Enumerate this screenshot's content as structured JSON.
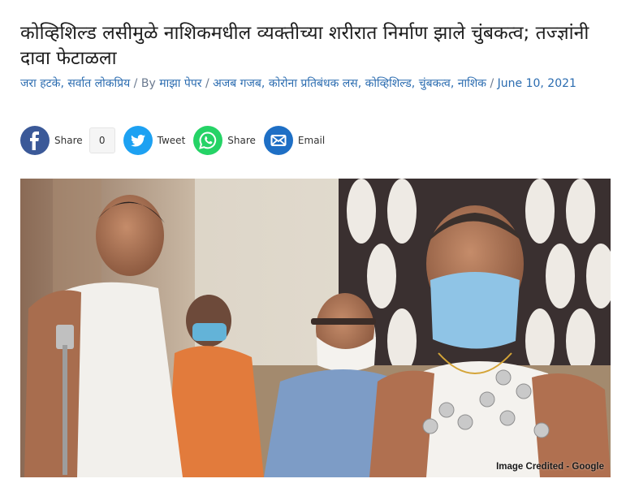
{
  "article": {
    "title": "कोव्हिशिल्ड लसीमुळे नाशिकमधील व्यक्तीच्या शरीरात निर्माण झाले चुंबकत्व; तज्ज्ञांनी दावा फेटाळला",
    "categories": [
      "जरा हटके",
      "सर्वात लोकप्रिय"
    ],
    "separator": " / ",
    "byline_prefix": "By ",
    "author": "माझा पेपर",
    "tags": [
      "अजब गजब",
      "कोरोना प्रतिबंधक लस",
      "कोव्हिशिल्ड",
      "चुंबकत्व",
      "नाशिक"
    ],
    "date": "June 10, 2021"
  },
  "share": {
    "facebook": {
      "label": "Share",
      "count": "0",
      "icon": "facebook-icon",
      "color": "#3b5998"
    },
    "twitter": {
      "label": "Tweet",
      "icon": "twitter-icon",
      "color": "#1da1f2"
    },
    "whatsapp": {
      "label": "Share",
      "icon": "whatsapp-icon",
      "color": "#25d366"
    },
    "email": {
      "label": "Email",
      "icon": "email-icon",
      "color": "#1e6fc5"
    }
  },
  "image": {
    "credit": "Image Credited -  Google"
  }
}
